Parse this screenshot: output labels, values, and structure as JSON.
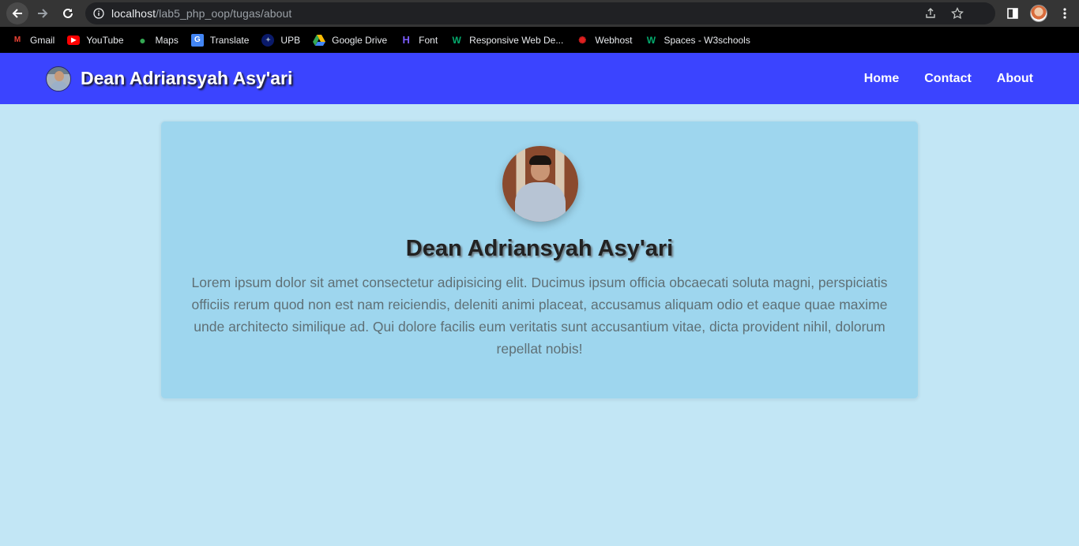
{
  "browser": {
    "url_host": "localhost",
    "url_path": "/lab5_php_oop/tugas/about",
    "bookmarks": [
      {
        "label": "Gmail",
        "icon": "gmail-icon"
      },
      {
        "label": "YouTube",
        "icon": "youtube-icon"
      },
      {
        "label": "Maps",
        "icon": "maps-icon"
      },
      {
        "label": "Translate",
        "icon": "translate-icon"
      },
      {
        "label": "UPB",
        "icon": "upb-icon"
      },
      {
        "label": "Google Drive",
        "icon": "drive-icon"
      },
      {
        "label": "Font",
        "icon": "font-icon"
      },
      {
        "label": "Responsive Web De...",
        "icon": "w3-icon"
      },
      {
        "label": "Webhost",
        "icon": "webhost-icon"
      },
      {
        "label": "Spaces - W3schools",
        "icon": "w3-icon"
      }
    ]
  },
  "navbar": {
    "brand": "Dean Adriansyah Asy'ari",
    "links": [
      "Home",
      "Contact",
      "About"
    ],
    "color": "#3b44ff"
  },
  "card": {
    "name": "Dean Adriansyah Asy'ari",
    "bio": "Lorem ipsum dolor sit amet consectetur adipisicing elit. Ducimus ipsum officia obcaecati soluta magni, perspiciatis officiis rerum quod non est nam reiciendis, deleniti animi placeat, accusamus aliquam odio et eaque quae maxime unde architecto similique ad. Qui dolore facilis eum veritatis sunt accusantium vitae, dicta provident nihil, dolorum repellat nobis!"
  }
}
